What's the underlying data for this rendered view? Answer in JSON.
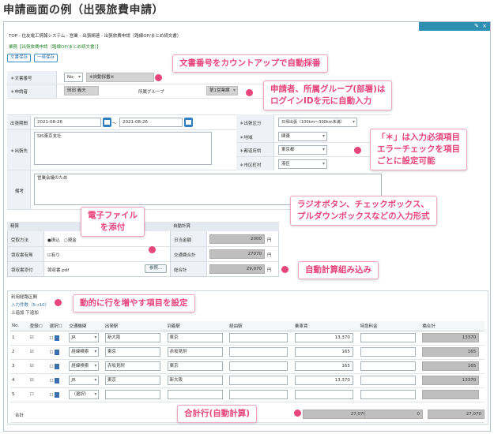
{
  "heading": "申請画面の例（出張旅費申請）",
  "breadcrumb": "TOP - 住友電工情報システム - 営業 - 出張関連 - 出張旅費申請（路線OP/まとめ続文書）",
  "subcrumb": "業務【出張旅費申請（路線OP/まとめ続文書）】",
  "toolbar": {
    "save": "文書保存",
    "temp_save": "一時保存"
  },
  "doc_number": {
    "label": "文書番号",
    "prefix": "No-",
    "value": "※自動採番※"
  },
  "applicant": {
    "label": "申請者",
    "name": "岡田 義夫",
    "group_label": "所属グループ",
    "group": "第1営業課"
  },
  "trip": {
    "period_label": "出張期間",
    "start": "2021-08-26",
    "tilde": "〜",
    "end": "2021-08-26",
    "dest_label": "出張先",
    "dest": "SIS東京支社",
    "note_label": "備考",
    "note": "営業会議のため",
    "kubun_label": "出張区分",
    "kubun": "日帰出張（100km～300km未満）",
    "area_label": "地域",
    "area": "関東",
    "pref_label": "都道府県",
    "pref": "東京都",
    "city_label": "市区町村",
    "city": "港区"
  },
  "settle": {
    "title": "精算",
    "method_label": "受取方法",
    "opt1": "●振込",
    "opt2": "○現金",
    "receipt_label": "領収書有無",
    "receipt": "☑有り",
    "attach_label": "領収書添付",
    "attach_file": "領収書.pdf",
    "attach_btn": "参照..."
  },
  "auto": {
    "title": "自動計算",
    "daily_label": "日当金額",
    "daily": "2000",
    "traffic_label": "交通費合計",
    "traffic": "27070",
    "total_label": "総合計",
    "total": "29,070",
    "yen": "円"
  },
  "route": {
    "section": "利用経路区間",
    "count": "入力件数（5→10）",
    "add": "上追加 下追加",
    "headers": [
      "No.",
      "登録☐",
      "選択☐",
      "交通機関",
      "出発駅",
      "到着駅",
      "経由駅",
      "乗車賃",
      "特急料金",
      "橋合計"
    ],
    "rows": [
      {
        "no": "1",
        "reg": "☑",
        "pick": "☐",
        "mode": "JR",
        "from": "新大阪",
        "to": "東京",
        "via": "",
        "fare": "13,370",
        "express": "",
        "sum": "13370"
      },
      {
        "no": "2",
        "reg": "☑",
        "pick": "☐",
        "mode": "経緯検索",
        "from": "東京",
        "to": "赤坂見附",
        "via": "",
        "fare": "165",
        "express": "",
        "sum": "165"
      },
      {
        "no": "3",
        "reg": "☑",
        "pick": "☐",
        "mode": "経緯検索",
        "from": "赤坂見附",
        "to": "東京",
        "via": "",
        "fare": "165",
        "express": "",
        "sum": "165"
      },
      {
        "no": "4",
        "reg": "☑",
        "pick": "☐",
        "mode": "JR",
        "from": "東京",
        "to": "新大阪",
        "via": "",
        "fare": "13,370",
        "express": "",
        "sum": "13370"
      },
      {
        "no": "5",
        "reg": "☐",
        "pick": "☐",
        "mode": "（選択）",
        "from": "",
        "to": "",
        "via": "",
        "fare": "",
        "express": "",
        "sum": ""
      }
    ],
    "total_label": "合計",
    "total_fare": "27,070",
    "total_express": "0",
    "total_sum": "27,070"
  },
  "callouts": {
    "c1": "文書番号をカウントアップで自動採番",
    "c2a": "申請者、所属グループ(部署)は",
    "c2b": "ログインIDを元に自動入力",
    "c3a": "「＊」は入力必須項目",
    "c3b": "エラーチェックを項目",
    "c3c": "ごとに設定可能",
    "c4a": "ラジオボタン、チェックボックス、",
    "c4b": "プルダウンボックスなどの入力形式",
    "c5a": "電子ファイル",
    "c5b": "を添付",
    "c6": "自動計算組み込み",
    "c7": "動的に行を増やす項目を設定",
    "c8": "合計行(自動計算)"
  },
  "colors": {
    "accent": "#e8457a",
    "header": "#2f8fb3"
  }
}
